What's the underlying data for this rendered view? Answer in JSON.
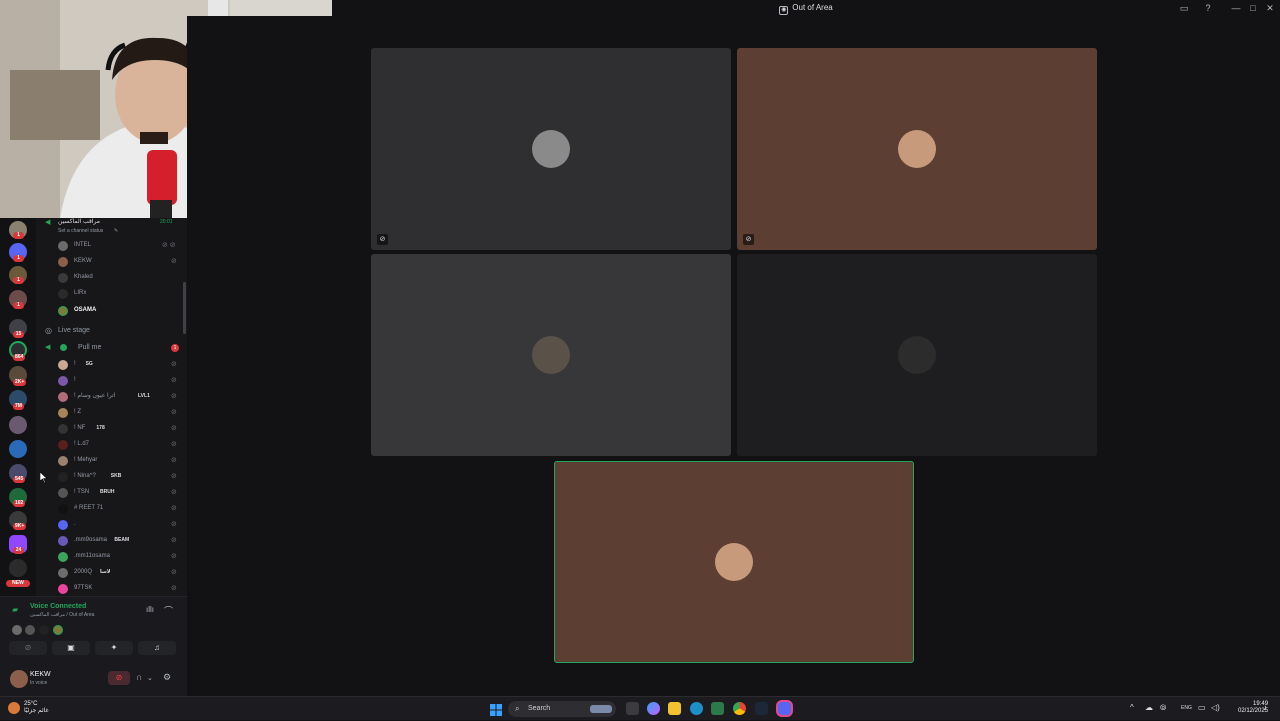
{
  "window": {
    "title": "Out of Area",
    "controls": [
      "—",
      "□",
      "✕"
    ]
  },
  "sidebar": {
    "header_channel": "مراقب الماكسين",
    "header_time": "20:01",
    "header_subtitle": "Set a channel status",
    "voice_users_top": [
      {
        "name": "INTEL",
        "color": "#6b6b6b"
      },
      {
        "name": "KEKW",
        "color": "#8c5f4c"
      },
      {
        "name": "Khaled",
        "color": "#3a3a3a"
      },
      {
        "name": "LIRx",
        "color": "#2a2a2a"
      },
      {
        "name": "OSAMA",
        "color": "#7d7a3a"
      }
    ],
    "live_stage_label": "Live stage",
    "pull_channel": {
      "name": "Pull me",
      "badge": "1"
    },
    "pull_users": [
      {
        "name": "!",
        "tag": "SG",
        "color": "#c9a894"
      },
      {
        "name": "!",
        "tag": "",
        "color": "#7a57a8"
      },
      {
        "name": "! اترا عيون وسام",
        "tag": "LVL1",
        "color": "#b06c7a"
      },
      {
        "name": "! Z",
        "tag": "",
        "color": "#a8845a"
      },
      {
        "name": "! NF",
        "tag": "178",
        "color": "#333333"
      },
      {
        "name": "! L.d7",
        "tag": "",
        "color": "#5a1e1e"
      },
      {
        "name": "! Mehyar",
        "tag": "",
        "color": "#9a8270"
      },
      {
        "name": "! Nina^?",
        "tag": "SKB",
        "color": "#222222"
      },
      {
        "name": "! TSN",
        "tag": "BRUH",
        "color": "#555555"
      },
      {
        "name": "# REET 71",
        "tag": "",
        "color": "#111111"
      },
      {
        "name": ".",
        "tag": "",
        "color": "#5865f2"
      },
      {
        "name": ".mm9osama",
        "tag": "BEAM",
        "color": "#6a58b8"
      },
      {
        "name": ".mm11osama",
        "tag": "",
        "color": "#3ba55c"
      },
      {
        "name": "2000Q",
        "tag": "لاسا",
        "color": "#6c6c6c"
      },
      {
        "name": "97TSK",
        "tag": "",
        "color": "#eb459e"
      }
    ]
  },
  "voice_panel": {
    "status": "Voice Connected",
    "location": "مراقب الماكسين / Out of Area"
  },
  "user_panel": {
    "username": "KEKW",
    "status": "In voice"
  },
  "rail_badges": [
    "1",
    "1",
    "1",
    "1",
    "15",
    "864",
    "2K+",
    "7M",
    "545",
    "102",
    "9K+",
    "24",
    "NEW"
  ],
  "stage_tiles": [
    {
      "bg": "#2f2f31",
      "ava": "#8a8a8a",
      "icon": "⊘"
    },
    {
      "bg": "#5c3e33",
      "ava": "#c89a7c",
      "icon": "⊘"
    },
    {
      "bg": "#373739",
      "ava": "#5a5248",
      "icon": ""
    },
    {
      "bg": "#1e1e20",
      "ava": "#2c2c2c",
      "icon": ""
    },
    {
      "bg": "#5c3e33",
      "ava": "#c89a7c",
      "icon": ""
    }
  ],
  "taskbar": {
    "weather_temp": "25°C",
    "weather_desc": "غائم جزئيًا",
    "search_placeholder": "Search",
    "time": "19:49",
    "date": "02/12/2025",
    "lang": "ENG"
  }
}
